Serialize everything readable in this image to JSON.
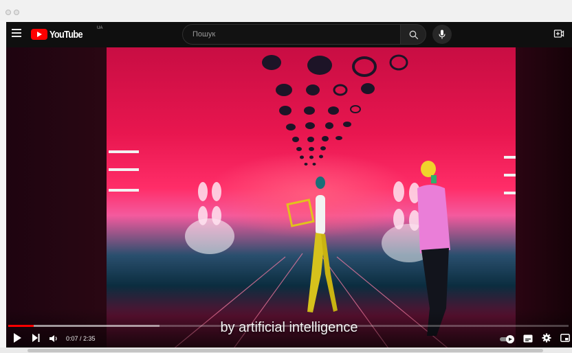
{
  "masthead": {
    "logo_text": "YouTube",
    "country_code": "UA",
    "search_placeholder": "Пошук"
  },
  "player": {
    "subtitle": "by artificial intelligence",
    "time_display": "0:07 / 2:35",
    "progress_played_fraction": 0.045,
    "progress_buffered_fraction": 0.27
  },
  "colors": {
    "brand_red": "#ff0000",
    "background": "#0f0f0f"
  },
  "icons": [
    "menu-icon",
    "youtube-logo-icon",
    "search-icon",
    "mic-icon",
    "create-icon",
    "play-icon",
    "next-icon",
    "volume-icon",
    "autoplay-toggle-icon",
    "subtitles-icon",
    "settings-icon",
    "miniplayer-icon"
  ]
}
